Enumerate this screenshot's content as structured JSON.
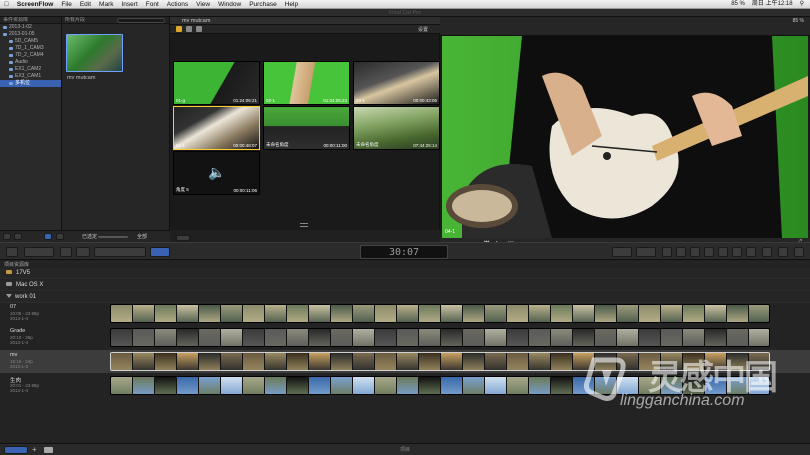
{
  "menubar": {
    "apple": "",
    "app": "ScreenFlow",
    "items": [
      "File",
      "Edit",
      "Mark",
      "Insert",
      "Font",
      "Actions",
      "View",
      "Window",
      "Purchase",
      "Help"
    ],
    "battery": "85 %",
    "clock": "周日 上午12:18"
  },
  "window": {
    "title": "Final Cut Pro",
    "left_label": "事件资源库"
  },
  "library": {
    "header": "事件资源库",
    "items": [
      {
        "label": "2013-1-02",
        "indent": 0
      },
      {
        "label": "2013-01-05",
        "indent": 0
      },
      {
        "label": "5D_CAM5",
        "indent": 1
      },
      {
        "label": "7D_1_CAM3",
        "indent": 1
      },
      {
        "label": "7D_2_CAM4",
        "indent": 1
      },
      {
        "label": "Audio",
        "indent": 1
      },
      {
        "label": "EX1_CAM2",
        "indent": 1
      },
      {
        "label": "EX3_CAM1",
        "indent": 1
      },
      {
        "label": "多机位",
        "indent": 1,
        "selected": true
      }
    ]
  },
  "browser": {
    "header": "所有片段",
    "clip_name": "mv mutcam",
    "footer_left": "已选定",
    "footer_right": "全部"
  },
  "angle_viewer": {
    "title": "mv mutcam",
    "settings": "设置",
    "angles": [
      {
        "name": "01-g",
        "tc": "01:24:06:21"
      },
      {
        "name": "02-1",
        "tc": "01:24:06:23"
      },
      {
        "name": "03-1",
        "tc": "00:00:43:05"
      },
      {
        "name": "04-1",
        "tc": "00:00:48:07",
        "selected": true
      },
      {
        "name": "未命名角度",
        "tc": "00:00:11:00"
      },
      {
        "name": "未命名角度",
        "tc": "07:44:25:14"
      },
      {
        "name": "角度 5",
        "tc": "00:00:11:06"
      }
    ]
  },
  "viewer": {
    "zoom": "85 %",
    "angle_label": "04-1"
  },
  "toolbar": {
    "timecode": "30:07"
  },
  "projects": {
    "title": "项目资源库",
    "folders": [
      "17V5",
      "Mac OS X",
      "work 01"
    ],
    "items": [
      {
        "name": "07",
        "info1": "10:05 - 23.98p",
        "info2": "2013-1-4"
      },
      {
        "name": "Grade",
        "info1": "20:10 - 25p",
        "info2": "2013-1-4"
      },
      {
        "name": "mv",
        "info1": "15:15 - 24p",
        "info2": "2013-1-3",
        "selected": true
      },
      {
        "name": "生肉",
        "info1": "20:01 - 23.98p",
        "info2": "2013-1-4"
      }
    ]
  },
  "bottom": {
    "label": "项目"
  },
  "watermark": {
    "main": "灵感中国",
    "url": "lingganchina.com"
  },
  "colors": {
    "selection": "#3a62b2",
    "angle_highlight": "#ffcc33",
    "green_screen": "#3fa734"
  }
}
